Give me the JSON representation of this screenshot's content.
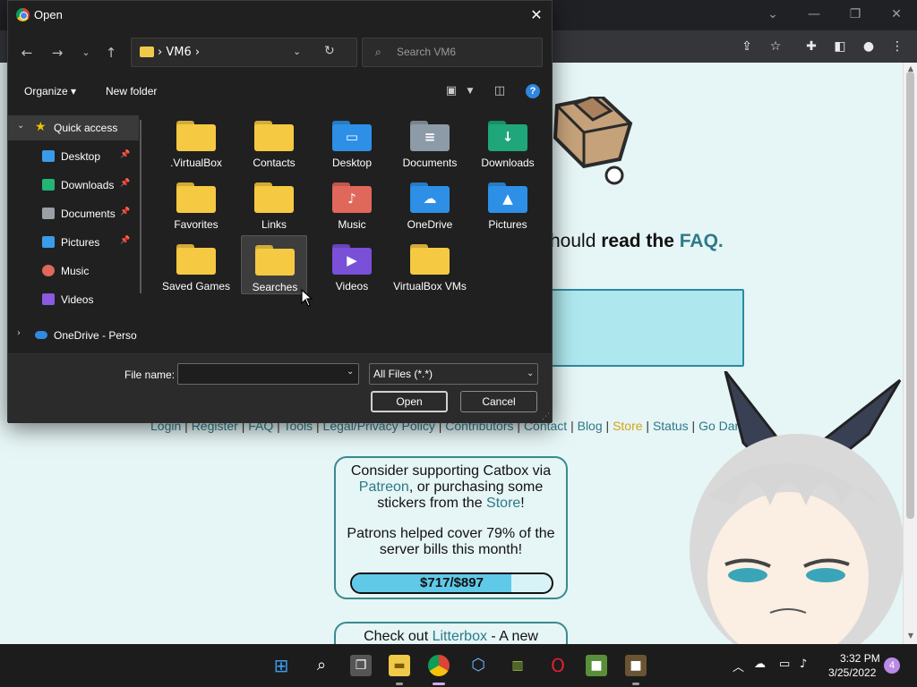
{
  "dialog": {
    "title": "Open",
    "address_path": "› VM6 ›",
    "search_placeholder": "Search VM6",
    "organize_label": "Organize ▾",
    "new_folder_label": "New folder",
    "filename_label": "File name:",
    "filename_value": "",
    "filter_value": "All Files (*.*)",
    "open_label": "Open",
    "cancel_label": "Cancel"
  },
  "nav_pane": [
    {
      "label": "Quick access",
      "icon": "star-icon",
      "color": "#f0c000",
      "pinned": false,
      "selected": true
    },
    {
      "label": "Desktop",
      "icon": "desktop-icon",
      "color": "#3a9be8",
      "pinned": true
    },
    {
      "label": "Downloads",
      "icon": "download-icon",
      "color": "#22b573",
      "pinned": true
    },
    {
      "label": "Documents",
      "icon": "documents-icon",
      "color": "#9aa0a6",
      "pinned": true
    },
    {
      "label": "Pictures",
      "icon": "pictures-icon",
      "color": "#3a9be8",
      "pinned": true
    },
    {
      "label": "Music",
      "icon": "music-icon",
      "color": "#e0685a",
      "pinned": false
    },
    {
      "label": "Videos",
      "icon": "videos-icon",
      "color": "#8a5be0",
      "pinned": false
    },
    {
      "label": "OneDrive - Perso",
      "icon": "onedrive-icon",
      "color": "#2f8ae0",
      "pinned": false
    }
  ],
  "folders": [
    {
      "label": ".VirtualBox",
      "icon": "folder-icon",
      "color": "#f6c942"
    },
    {
      "label": "Contacts",
      "icon": "folder-icon",
      "color": "#f6c942"
    },
    {
      "label": "Desktop",
      "icon": "desktop-folder-icon",
      "color": "#2e8fe6"
    },
    {
      "label": "Documents",
      "icon": "documents-folder-icon",
      "color": "#8d9aa8"
    },
    {
      "label": "Downloads",
      "icon": "downloads-folder-icon",
      "color": "#1fa67a"
    },
    {
      "label": "Favorites",
      "icon": "folder-icon",
      "color": "#f6c942"
    },
    {
      "label": "Links",
      "icon": "folder-icon",
      "color": "#f6c942"
    },
    {
      "label": "Music",
      "icon": "music-folder-icon",
      "color": "#e0685a"
    },
    {
      "label": "OneDrive",
      "icon": "onedrive-folder-icon",
      "color": "#2e8fe6"
    },
    {
      "label": "Pictures",
      "icon": "pictures-folder-icon",
      "color": "#2e8fe6"
    },
    {
      "label": "Saved Games",
      "icon": "folder-icon",
      "color": "#f6c942"
    },
    {
      "label": "Searches",
      "icon": "folder-icon",
      "color": "#f6c942"
    },
    {
      "label": "Videos",
      "icon": "videos-folder-icon",
      "color": "#7a50d8"
    },
    {
      "label": "VirtualBox VMs",
      "icon": "folder-icon",
      "color": "#f6c942"
    }
  ],
  "page": {
    "faq_prefix": "hould ",
    "faq_bold": "read the ",
    "faq_link": "FAQ",
    "faq_suffix": ".",
    "links": [
      "Login",
      "Register",
      "FAQ",
      "Tools",
      "Legal/Privacy Policy",
      "Contributors",
      "Contact",
      "Blog",
      "Store",
      "Status",
      "Go Dark?"
    ],
    "support_text_1": "Consider supporting Catbox via",
    "support_link_patreon": "Patreon",
    "support_text_2": ", or purchasing some stickers from the ",
    "support_link_store": "Store",
    "support_text_3": "!",
    "patrons_text": "Patrons helped cover 79% of the server bills this month!",
    "progress_label": "$717/$897",
    "progress_fraction": 0.8,
    "litter_text_1": "Check out ",
    "litter_link": "Litterbox",
    "litter_text_2": " - A new"
  },
  "taskbar": {
    "time": "3:32 PM",
    "date": "3/25/2022",
    "notifications": "4"
  },
  "colors": {
    "accent_link": "#2c7a89",
    "store_link": "#d4a418",
    "page_bg": "#e6f5f5",
    "progress_fill": "#60c9e8"
  }
}
